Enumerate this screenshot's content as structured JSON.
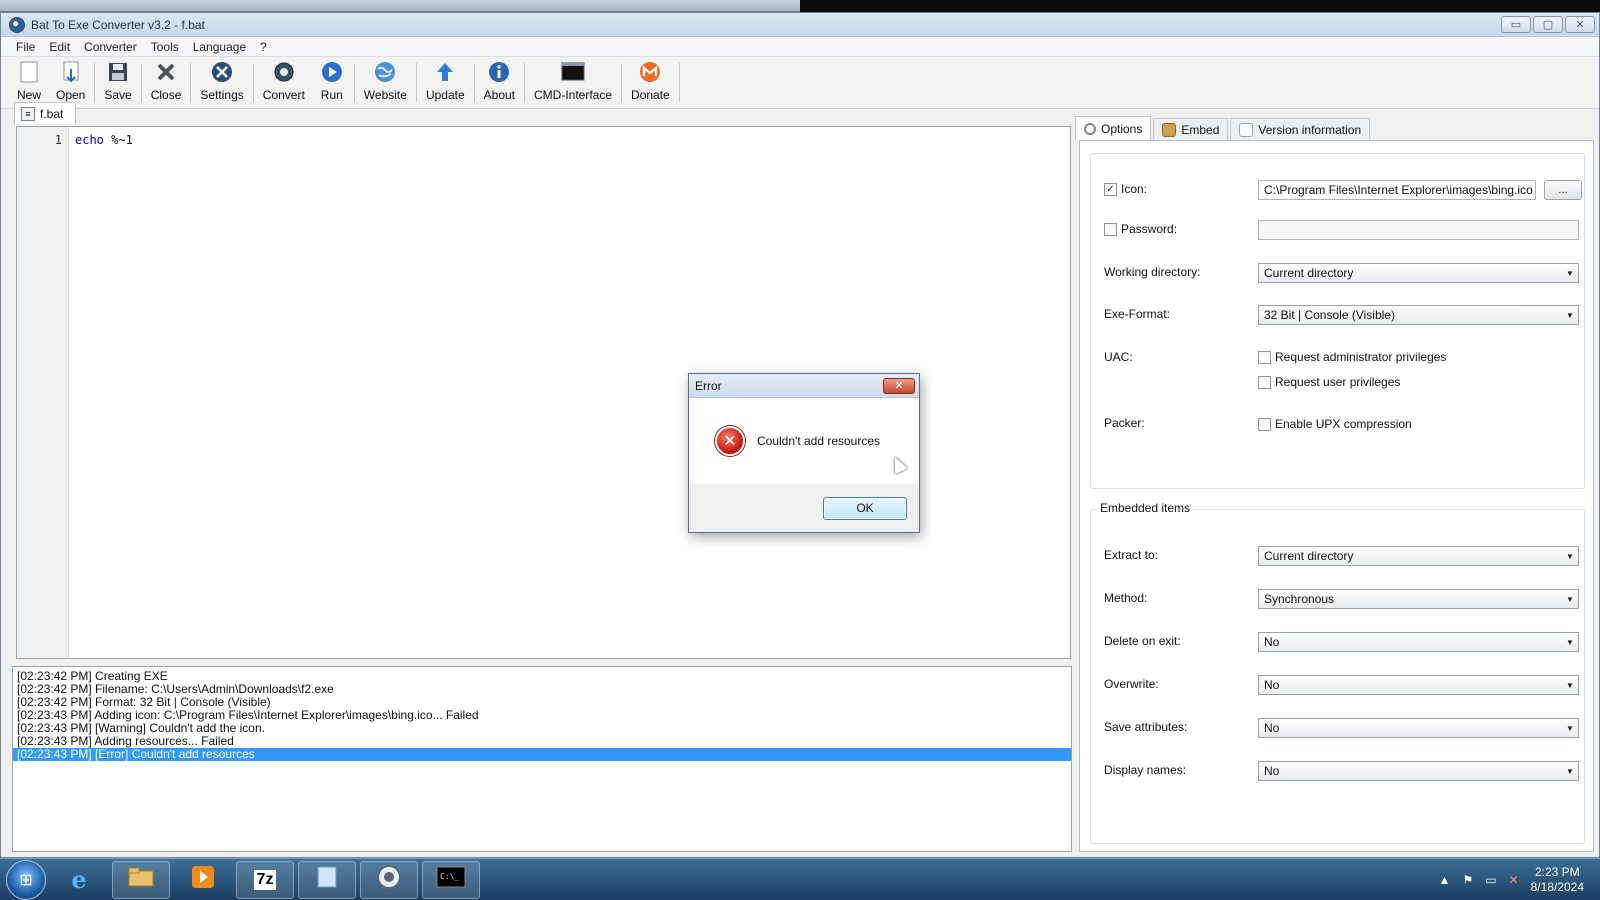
{
  "window": {
    "title": "Bat To Exe Converter v3.2 - f.bat",
    "controls": {
      "minimize": "▭",
      "maximize": "▢",
      "close": "✕"
    }
  },
  "menu": [
    "File",
    "Edit",
    "Converter",
    "Tools",
    "Language",
    "?"
  ],
  "toolbar": {
    "new": "New",
    "open": "Open",
    "save": "Save",
    "close": "Close",
    "settings": "Settings",
    "convert": "Convert",
    "run": "Run",
    "website": "Website",
    "update": "Update",
    "about": "About",
    "cmd": "CMD-Interface",
    "donate": "Donate"
  },
  "editor": {
    "tab_label": "f.bat",
    "line_number": "1",
    "code_keyword": "echo",
    "code_rest": " %~1"
  },
  "log": [
    "[02:23:42 PM] Creating EXE",
    "[02:23:42 PM] Filename: C:\\Users\\Admin\\Downloads\\f2.exe",
    "[02:23:42 PM] Format: 32 Bit | Console (Visible)",
    "[02:23:43 PM] Adding icon: C:\\Program Files\\Internet Explorer\\images\\bing.ico... Failed",
    "[02:23:43 PM] [Warning] Couldn't add the icon.",
    "[02:23:43 PM] Adding resources... Failed",
    "[02:23:43 PM] [Error] Couldn't add resources"
  ],
  "right_tabs": {
    "options": "Options",
    "embed": "Embed",
    "version": "Version information"
  },
  "options": {
    "icon_label": "Icon:",
    "icon_checked": "✓",
    "icon_path": "C:\\Program Files\\Internet Explorer\\images\\bing.ico",
    "browse": "...",
    "password_label": "Password:",
    "password_value": "",
    "workdir_label": "Working directory:",
    "workdir_value": "Current directory",
    "exeformat_label": "Exe-Format:",
    "exeformat_value": "32 Bit | Console (Visible)",
    "uac_label": "UAC:",
    "uac_admin": "Request administrator privileges",
    "uac_user": "Request user privileges",
    "packer_label": "Packer:",
    "packer_upx": "Enable UPX compression"
  },
  "embedded": {
    "title": "Embedded items",
    "extract_label": "Extract to:",
    "extract_value": "Current directory",
    "method_label": "Method:",
    "method_value": "Synchronous",
    "delete_label": "Delete on exit:",
    "delete_value": "No",
    "overwrite_label": "Overwrite:",
    "overwrite_value": "No",
    "saveattr_label": "Save attributes:",
    "saveattr_value": "No",
    "display_label": "Display names:",
    "display_value": "No"
  },
  "dialog": {
    "title": "Error",
    "message": "Couldn't add resources",
    "ok": "OK",
    "close": "✕"
  },
  "taskbar": {
    "time": "2:23 PM",
    "date": "8/18/2024",
    "items": [
      "start",
      "internet-explorer",
      "file-explorer",
      "media-player",
      "7-zip",
      "notepad",
      "settings",
      "cmd"
    ]
  }
}
